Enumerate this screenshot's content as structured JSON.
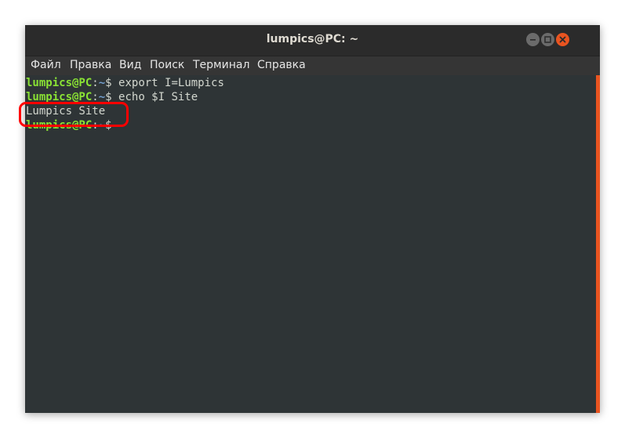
{
  "window": {
    "title": "lumpics@PC: ~"
  },
  "menu": [
    "Файл",
    "Правка",
    "Вид",
    "Поиск",
    "Терминал",
    "Справка"
  ],
  "terminal": {
    "prompt_user": "lumpics@PC",
    "prompt_colon": ":",
    "prompt_path": "~",
    "prompt_dollar": "$",
    "lines": [
      {
        "type": "command",
        "command": " export I=Lumpics"
      },
      {
        "type": "command",
        "command": " echo $I Site"
      },
      {
        "type": "output",
        "text": "Lumpics Site"
      },
      {
        "type": "command",
        "command": ""
      }
    ]
  },
  "colors": {
    "prompt_user": "#8ae234",
    "prompt_path": "#729fcf",
    "terminal_bg": "#2e3436",
    "accent": "#e95420",
    "highlight": "#ff0000"
  }
}
